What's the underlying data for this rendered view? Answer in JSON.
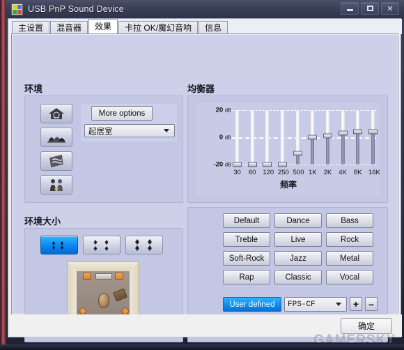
{
  "window": {
    "title": "USB PnP Sound Device",
    "icon": "sound-device-icon",
    "minimize_label": "–",
    "maximize_label": "□",
    "close_label": "✕"
  },
  "tabs": [
    {
      "label": "主设置",
      "active": false
    },
    {
      "label": "混音器",
      "active": false
    },
    {
      "label": "效果",
      "active": true
    },
    {
      "label": "卡拉 OK/魔幻音响",
      "active": false
    },
    {
      "label": "信息",
      "active": false
    }
  ],
  "environment": {
    "title": "环境",
    "icons": [
      {
        "name": "house-environment-icon"
      },
      {
        "name": "opera-house-environment-icon"
      },
      {
        "name": "stone-environment-icon"
      },
      {
        "name": "people-environment-icon"
      }
    ],
    "more_options_label": "More options",
    "selected_preset": "起居室"
  },
  "environment_size": {
    "title": "环境大小",
    "options": [
      {
        "name": "size-small",
        "selected": true
      },
      {
        "name": "size-medium",
        "selected": false
      },
      {
        "name": "size-large",
        "selected": false
      }
    ]
  },
  "equalizer": {
    "title": "均衡器",
    "freq_axis_label": "频率",
    "db_labels": [
      {
        "value": "20",
        "unit": "dB"
      },
      {
        "value": "0",
        "unit": "dB"
      },
      {
        "value": "-20",
        "unit": "dB"
      }
    ]
  },
  "presets": [
    "Default",
    "Dance",
    "Bass",
    "Treble",
    "Live",
    "Rock",
    "Soft-Rock",
    "Jazz",
    "Metal",
    "Rap",
    "Classic",
    "Vocal"
  ],
  "user_preset": {
    "label": "User defined",
    "selected": "FPS-CF",
    "add_label": "+",
    "remove_label": "–",
    "input_value": ""
  },
  "footer": {
    "ok_label": "确定"
  },
  "watermark": "GAMERSKY",
  "colors": {
    "panel": "#cdd0e8",
    "group_body": "#c3c7e4",
    "accent_blue": "#0a8ef2",
    "titlebar": "#3a4058"
  },
  "chart_data": {
    "type": "bar",
    "title": "均衡器",
    "xlabel": "频率",
    "ylabel": "dB",
    "ylim": [
      -20,
      20
    ],
    "categories": [
      "30",
      "60",
      "120",
      "250",
      "500",
      "1K",
      "2K",
      "4K",
      "8K",
      "16K"
    ],
    "values": [
      -20,
      -20,
      -20,
      -20,
      -12,
      0,
      1,
      3,
      4,
      4
    ],
    "grid": true,
    "legend": "none"
  }
}
